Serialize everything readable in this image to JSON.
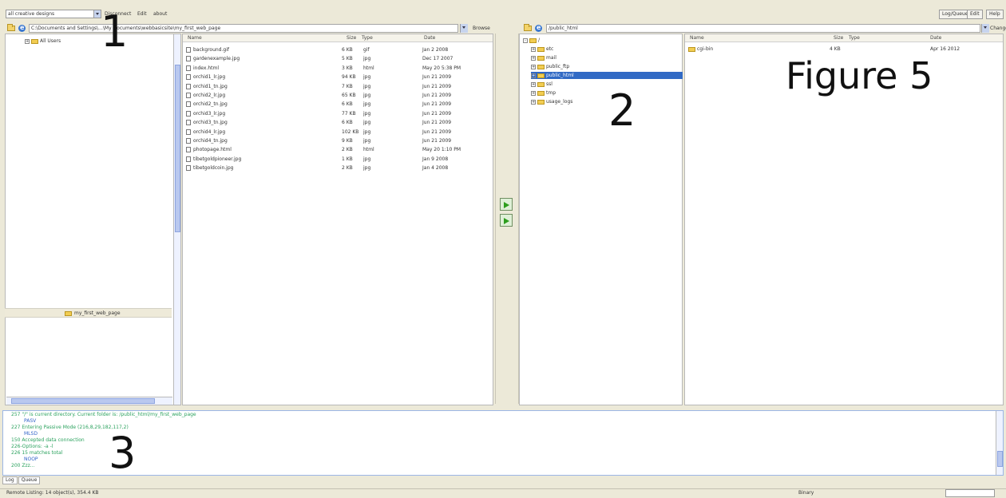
{
  "toolbar": {
    "site_selector": "all creative designs",
    "menu": [
      "Disconnect",
      "Edit",
      "about"
    ],
    "right_buttons": [
      "Log/Queue",
      "Edit",
      "Help"
    ]
  },
  "local": {
    "path": "C:\\Documents and Settings\\...\\My Documents\\webbasicsite\\my_first_web_page",
    "browse_label": "Browse",
    "tree_root": "All Users",
    "current_folder": "my_first_web_page",
    "columns": [
      "Name",
      "Size",
      "Type",
      "Date"
    ],
    "files": [
      {
        "name": "background.gif",
        "size": "6 KB",
        "type": "gif",
        "date": "Jan 2 2008"
      },
      {
        "name": "gardenexample.jpg",
        "size": "5 KB",
        "type": "jpg",
        "date": "Dec 17 2007"
      },
      {
        "name": "index.html",
        "size": "3 KB",
        "type": "html",
        "date": "May 20 5:38 PM"
      },
      {
        "name": "orchid1_lr.jpg",
        "size": "94 KB",
        "type": "jpg",
        "date": "Jun 21 2009"
      },
      {
        "name": "orchid1_tn.jpg",
        "size": "7 KB",
        "type": "jpg",
        "date": "Jun 21 2009"
      },
      {
        "name": "orchid2_lr.jpg",
        "size": "65 KB",
        "type": "jpg",
        "date": "Jun 21 2009"
      },
      {
        "name": "orchid2_tn.jpg",
        "size": "6 KB",
        "type": "jpg",
        "date": "Jun 21 2009"
      },
      {
        "name": "orchid3_lr.jpg",
        "size": "77 KB",
        "type": "jpg",
        "date": "Jun 21 2009"
      },
      {
        "name": "orchid3_tn.jpg",
        "size": "6 KB",
        "type": "jpg",
        "date": "Jun 21 2009"
      },
      {
        "name": "orchid4_lr.jpg",
        "size": "102 KB",
        "type": "jpg",
        "date": "Jun 21 2009"
      },
      {
        "name": "orchid4_tn.jpg",
        "size": "9 KB",
        "type": "jpg",
        "date": "Jun 21 2009"
      },
      {
        "name": "photopage.html",
        "size": "2 KB",
        "type": "html",
        "date": "May 20 1:10 PM"
      },
      {
        "name": "tibetgoldpioneer.jpg",
        "size": "1 KB",
        "type": "jpg",
        "date": "Jan 9 2008"
      },
      {
        "name": "tibetgoldcoin.jpg",
        "size": "2 KB",
        "type": "jpg",
        "date": "Jan 4 2008"
      }
    ]
  },
  "remote": {
    "path": "/public_html",
    "change_label": "Change",
    "tree_root": "/",
    "tree_items": [
      "etc",
      "mail",
      "public_ftp",
      "public_html",
      "ssl",
      "tmp",
      "usage_logs"
    ],
    "selected_item": "public_html",
    "columns": [
      "Name",
      "Size",
      "Type",
      "Date"
    ],
    "files": [
      {
        "name": "cgi-bin",
        "size": "4 KB",
        "type": "",
        "date": "Apr 16 2012"
      }
    ]
  },
  "log": {
    "lines": [
      {
        "text": "257 \"/\" is current directory. Current folder is: /public_html/my_first_web_page",
        "color": "green"
      },
      {
        "text": "PASV",
        "color": "blue"
      },
      {
        "text": "227 Entering Passive Mode (216,8,29,182,117,2)",
        "color": "green"
      },
      {
        "text": "MLSD",
        "color": "blue"
      },
      {
        "text": "150 Accepted data connection",
        "color": "green"
      },
      {
        "text": "226-Options: -a -l",
        "color": "green"
      },
      {
        "text": "226 15 matches total",
        "color": "green"
      },
      {
        "text": "NOOP",
        "color": "blue"
      },
      {
        "text": "200 Zzz...",
        "color": "green"
      }
    ],
    "tabs": [
      "Log",
      "Queue"
    ]
  },
  "status": {
    "left": "Remote Listing: 14 object(s), 354.4 KB",
    "mode": "Binary"
  },
  "overlays": {
    "number_1": "1",
    "number_2": "2",
    "number_3": "3",
    "figure_label": "Figure 5"
  }
}
